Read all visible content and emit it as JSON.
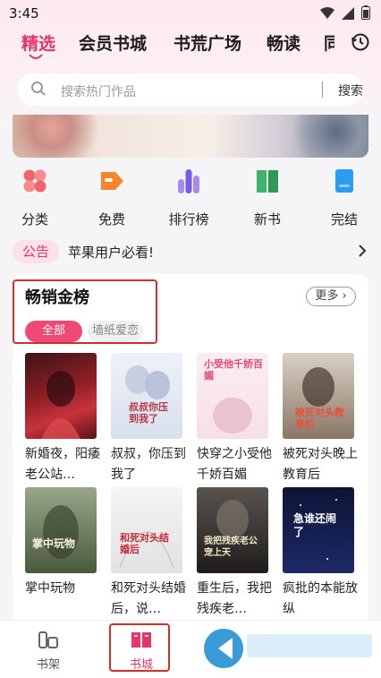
{
  "status_bar": {
    "time": "3:45"
  },
  "category_tabs": [
    {
      "label": "精选",
      "active": true
    },
    {
      "label": "会员书城",
      "active": false
    },
    {
      "label": "书荒广场",
      "active": false
    },
    {
      "label": "畅读",
      "active": false
    },
    {
      "label": "同",
      "active": false
    }
  ],
  "search": {
    "placeholder": "搜索热门作品",
    "button": "搜索"
  },
  "quick_nav": [
    {
      "label": "分类",
      "icon": "category-icon",
      "color": "#f2636a"
    },
    {
      "label": "免费",
      "icon": "tag-icon",
      "color": "#f6862a"
    },
    {
      "label": "排行榜",
      "icon": "ranking-icon",
      "color": "#8a6cf0"
    },
    {
      "label": "新书",
      "icon": "book-icon",
      "color": "#3cb46a"
    },
    {
      "label": "完结",
      "icon": "document-icon",
      "color": "#2b9cf2"
    }
  ],
  "notice": {
    "badge": "公告",
    "text": "苹果用户必看!"
  },
  "bestseller": {
    "title": "畅销金榜",
    "more": "更多",
    "chips": [
      "全部",
      "墙纸爱恋"
    ],
    "books": [
      {
        "title": "新婚夜，阳痿老公站…"
      },
      {
        "title": "叔叔，你压到我了",
        "cover_text": "叔叔你压到我了"
      },
      {
        "title": "快穿之小受他千娇百媚",
        "cover_text": "小受他千娇百媚"
      },
      {
        "title": "被死对头晚上教育后",
        "cover_text": "被死对头教育后"
      },
      {
        "title": "掌中玩物",
        "cover_text": "掌中玩物"
      },
      {
        "title": "和死对头结婚后，说…",
        "cover_text": "和死对头结婚后"
      },
      {
        "title": "重生后，我把残疾老…",
        "cover_text": "我把残疾老公宠上天"
      },
      {
        "title": "疯批的本能放纵",
        "cover_text": "急谁还闹了"
      }
    ]
  },
  "bottom_nav": [
    {
      "label": "书架",
      "icon": "bookshelf-icon",
      "active": false
    },
    {
      "label": "书城",
      "icon": "bookstore-icon",
      "active": true
    }
  ],
  "colors": {
    "accent": "#e8346c",
    "annotation_box": "#d0302a"
  }
}
